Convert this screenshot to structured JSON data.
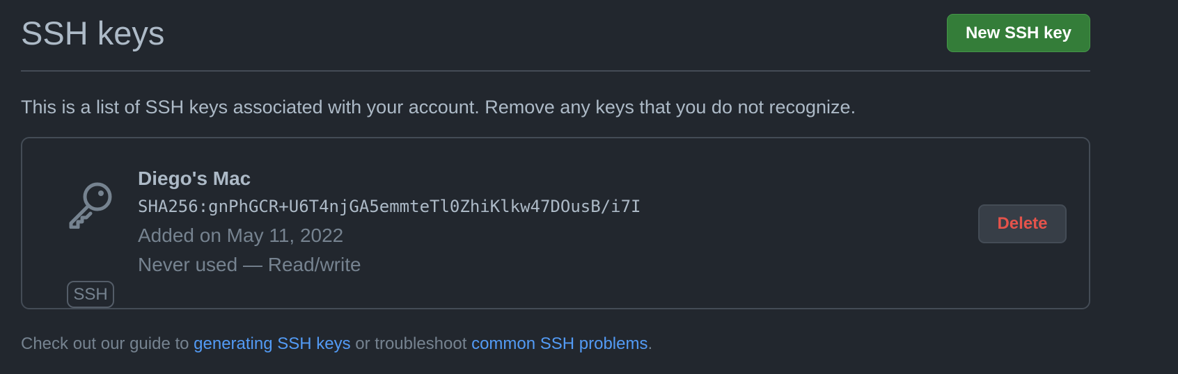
{
  "header": {
    "title": "SSH keys",
    "new_key_label": "New SSH key"
  },
  "description": "This is a list of SSH keys associated with your account. Remove any keys that you do not recognize.",
  "keys": [
    {
      "icon": "key-icon",
      "type_label": "SSH",
      "name": "Diego's Mac",
      "fingerprint": "SHA256:gnPhGCR+U6T4njGA5emmteTl0ZhiKlkw47DOusB/i7I",
      "added": "Added on May 11, 2022",
      "usage": "Never used — Read/write",
      "delete_label": "Delete"
    }
  ],
  "footer": {
    "prefix": "Check out our guide to ",
    "link1": "generating SSH keys",
    "middle": " or troubleshoot ",
    "link2": "common SSH problems",
    "suffix": "."
  },
  "colors": {
    "background": "#22272e",
    "primary_button": "#347d39",
    "danger_text": "#e5534b",
    "link": "#539bf5",
    "border": "#444c56"
  }
}
